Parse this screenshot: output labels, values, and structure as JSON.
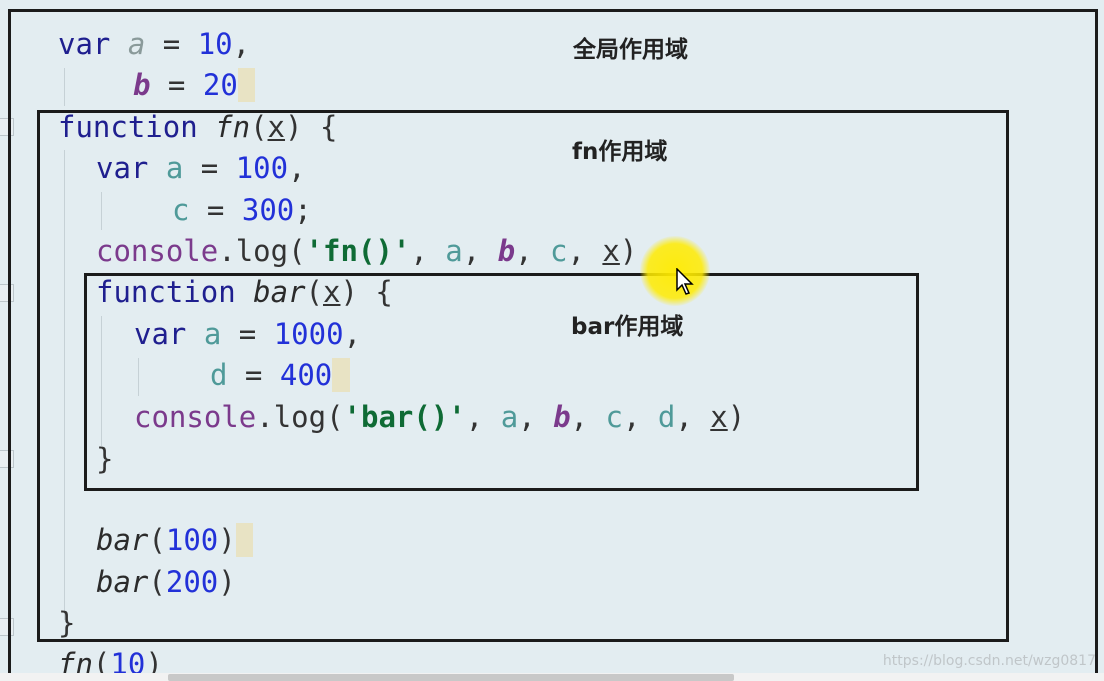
{
  "labels": {
    "global_scope": "全局作用域",
    "fn_scope": "fn作用域",
    "bar_scope": "bar作用域"
  },
  "code": {
    "line1": {
      "kw": "var",
      "a": "a",
      "eq": " = ",
      "num": "10",
      "tail": ","
    },
    "line2": {
      "b": "b",
      "eq": " = ",
      "num": "20"
    },
    "line3": {
      "kw": "function",
      "name": "fn",
      "open": "(",
      "param": "x",
      "close": ")",
      "brace": " {"
    },
    "line4": {
      "kw": "var",
      "a": "a",
      "eq": " = ",
      "num": "100",
      "tail": ","
    },
    "line5": {
      "c": "c",
      "eq": " = ",
      "num": "300",
      "tail": ";"
    },
    "line6": {
      "obj": "console",
      "dot": ".",
      "meth": "log",
      "open": "(",
      "str": "'fn()'",
      "sep1": ", ",
      "a": "a",
      "sep2": ", ",
      "b": "b",
      "sep3": ", ",
      "c": "c",
      "sep4": ", ",
      "x": "x",
      "close": ")"
    },
    "line7": {
      "kw": "function",
      "name": "bar",
      "open": "(",
      "param": "x",
      "close": ")",
      "brace": " {"
    },
    "line8": {
      "kw": "var",
      "a": "a",
      "eq": " = ",
      "num": "1000",
      "tail": ","
    },
    "line9": {
      "d": "d",
      "eq": " = ",
      "num": "400"
    },
    "line10": {
      "obj": "console",
      "dot": ".",
      "meth": "log",
      "open": "(",
      "str": "'bar()'",
      "sep1": ", ",
      "a": "a",
      "sep2": ", ",
      "b": "b",
      "sep3": ", ",
      "c": "c",
      "sep4": ", ",
      "d": "d",
      "sep5": ", ",
      "x": "x",
      "close": ")"
    },
    "line11": {
      "brace": "}"
    },
    "line12": {
      "name": "bar",
      "open": "(",
      "num": "100",
      "close": ")"
    },
    "line13": {
      "name": "bar",
      "open": "(",
      "num": "200",
      "close": ")"
    },
    "line14": {
      "brace": "}"
    },
    "line15": {
      "name": "fn",
      "open": "(",
      "num": "10",
      "close": ")"
    }
  },
  "watermark": "https://blog.csdn.net/wzg0817"
}
